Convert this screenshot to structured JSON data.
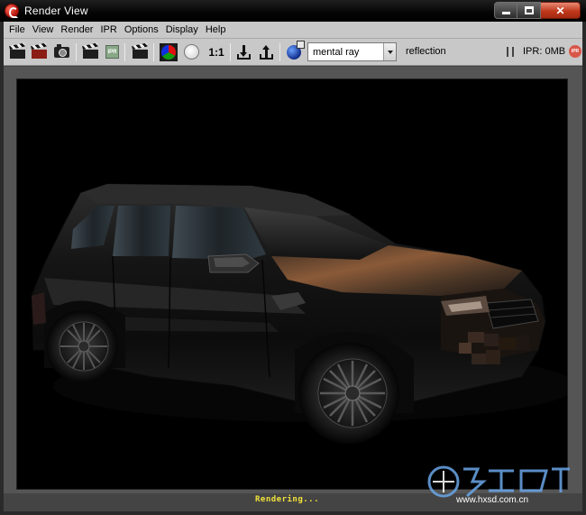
{
  "window": {
    "title": "Render View",
    "controls": [
      "minimize-icon",
      "maximize-icon",
      "close-icon"
    ]
  },
  "menubar": {
    "items": [
      "File",
      "View",
      "Render",
      "IPR",
      "Options",
      "Display",
      "Help"
    ]
  },
  "toolbar": {
    "ratio_label": "1:1",
    "renderer": "mental ray",
    "render_layer": "reflection",
    "ipr_memory": "IPR: 0MB",
    "ipr_badge": "IPR",
    "ipr_icon_text": "IPR"
  },
  "status": {
    "text": "Rendering..."
  },
  "watermark": {
    "text": "www.hxsd.com.cn"
  },
  "colors": {
    "status_text": "#f2e23c",
    "render_background": "#000000",
    "toolbar_bg": "#c8c8c8"
  }
}
